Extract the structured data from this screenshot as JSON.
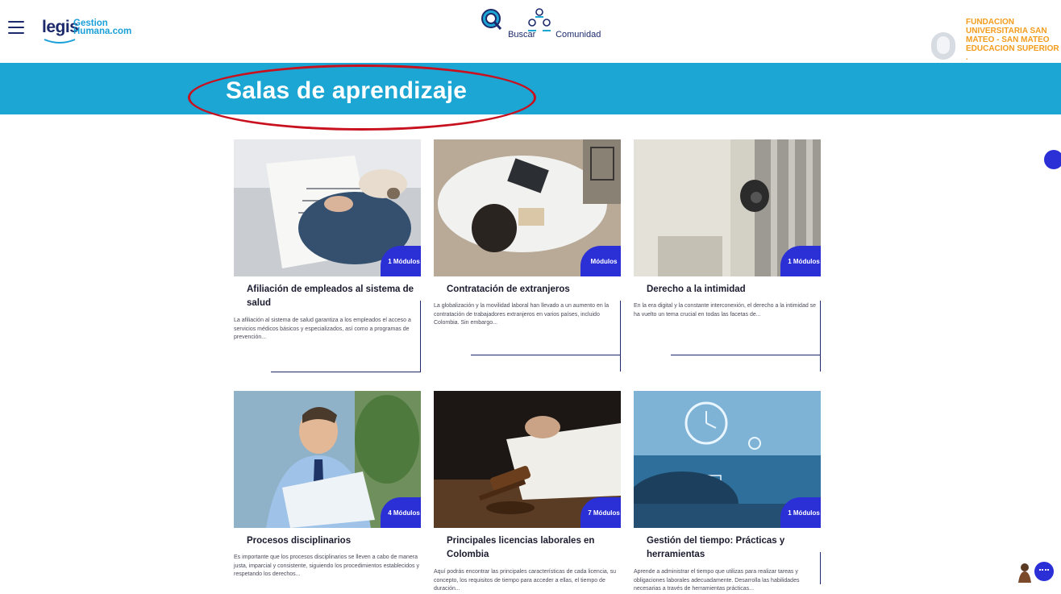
{
  "header": {
    "logo_main": "legis",
    "logo_sub_1": "Gestion",
    "logo_sub_2": "Humana.com",
    "nav": [
      {
        "label": "Buscar",
        "icon": "search-icon"
      },
      {
        "label": "Comunidad",
        "icon": "community-icon"
      }
    ],
    "org_name": "FUNDACION UNIVERSITARIA SAN MATEO - SAN MATEO EDUCACION SUPERIOR ."
  },
  "banner": {
    "title": "Salas de aprendizaje"
  },
  "colors": {
    "brand_blue": "#1ba6d4",
    "navy": "#1c2a6b",
    "badge": "#2b2fd6",
    "org": "#f39c1c",
    "highlight": "#c8101e"
  },
  "cards": [
    {
      "title": "Afiliación de empleados al sistema de salud",
      "badge": "1 Módulos",
      "desc": "La afiliación al sistema de salud garantiza a los empleados el acceso a servicios médicos básicos y especializados, así como a programas de prevención..."
    },
    {
      "title": "Contratación de extranjeros",
      "badge": "Módulos",
      "desc": "La globalización y la movilidad laboral han llevado a un aumento en la contratación de trabajadores extranjeros en varios países, incluido Colombia. Sin embargo..."
    },
    {
      "title": "Derecho a la intimidad",
      "badge": "1 Módulos",
      "desc": "En la era digital y la constante interconexión, el derecho a la intimidad se ha vuelto un tema crucial en todas las facetas de..."
    },
    {
      "title": "Procesos disciplinarios",
      "badge": "4 Módulos",
      "desc": "Es importante que los procesos disciplinarios se lleven a cabo de manera justa, imparcial y consistente, siguiendo los procedimientos establecidos y respetando los derechos..."
    },
    {
      "title": "Principales licencias laborales en Colombia",
      "badge": "7 Módulos",
      "desc": "Aquí podrás encontrar las principales características de cada licencia, su concepto, los requisitos de tiempo para acceder a ellas, el tiempo de duración..."
    },
    {
      "title": "Gestión del tiempo: Prácticas y herramientas",
      "badge": "1 Módulos",
      "desc": "Aprende a administrar el tiempo que utilizas para realizar tareas y obligaciones laborales adecuadamente. Desarrolla las habilidades necesarias a través de herramientas prácticas..."
    }
  ]
}
